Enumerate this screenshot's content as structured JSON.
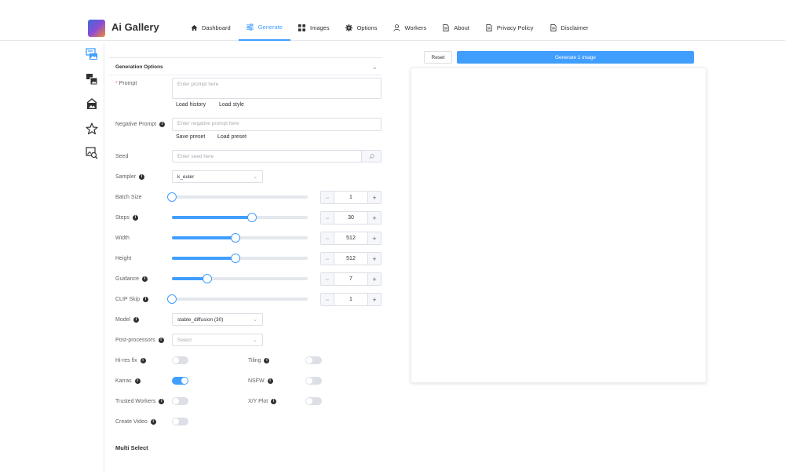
{
  "app": {
    "title": "Ai Gallery"
  },
  "nav": [
    {
      "label": "Dashboard",
      "icon": "home-icon"
    },
    {
      "label": "Generate",
      "icon": "sliders-icon",
      "active": true
    },
    {
      "label": "Images",
      "icon": "grid-icon"
    },
    {
      "label": "Options",
      "icon": "gear-icon"
    },
    {
      "label": "Workers",
      "icon": "user-icon"
    },
    {
      "label": "About",
      "icon": "document-icon"
    },
    {
      "label": "Privacy Policy",
      "icon": "document-icon"
    },
    {
      "label": "Disclaimer",
      "icon": "document-icon"
    }
  ],
  "sidebar": [
    {
      "icon": "text-to-image-icon",
      "active": true
    },
    {
      "icon": "image-to-image-icon"
    },
    {
      "icon": "inpainting-icon"
    },
    {
      "icon": "rating-star-icon"
    },
    {
      "icon": "image-search-icon"
    }
  ],
  "panel": {
    "title": "Generation Options"
  },
  "form": {
    "prompt": {
      "label": "Prompt",
      "placeholder": "Enter prompt here",
      "links": [
        "Load history",
        "Load style"
      ]
    },
    "negative": {
      "label": "Negative Prompt",
      "placeholder": "Enter negative prompt here",
      "links": [
        "Save preset",
        "Load preset"
      ]
    },
    "seed": {
      "label": "Seed",
      "placeholder": "Enter seed here"
    },
    "sampler": {
      "label": "Sampler",
      "value": "k_euler"
    },
    "batch": {
      "label": "Batch Size",
      "value": "1",
      "fraction": 0.0
    },
    "steps": {
      "label": "Steps",
      "value": "30",
      "fraction": 0.59
    },
    "width": {
      "label": "Width",
      "value": "512",
      "fraction": 0.47
    },
    "height": {
      "label": "Height",
      "value": "512",
      "fraction": 0.47
    },
    "guidance": {
      "label": "Guidance",
      "value": "7",
      "fraction": 0.26
    },
    "clip": {
      "label": "CLIP Skip",
      "value": "1",
      "fraction": 0.0
    },
    "model": {
      "label": "Model",
      "value": "stable_diffusion (30)"
    },
    "post": {
      "label": "Post-processors",
      "placeholder": "Select"
    },
    "hires": {
      "label": "Hi-res fix",
      "on": false
    },
    "tiling": {
      "label": "Tiling",
      "on": false
    },
    "karras": {
      "label": "Karras",
      "on": true
    },
    "nsfw": {
      "label": "NSFW",
      "on": false
    },
    "trusted": {
      "label": "Trusted Workers",
      "on": false
    },
    "xyplot": {
      "label": "X/Y Plot",
      "on": false
    },
    "video": {
      "label": "Create Video",
      "on": false
    }
  },
  "multi_select": {
    "title": "Multi Select"
  },
  "actions": {
    "reset": "Reset",
    "generate": "Generate 1 image"
  },
  "colors": {
    "accent": "#409eff",
    "border": "#dcdfe6"
  }
}
